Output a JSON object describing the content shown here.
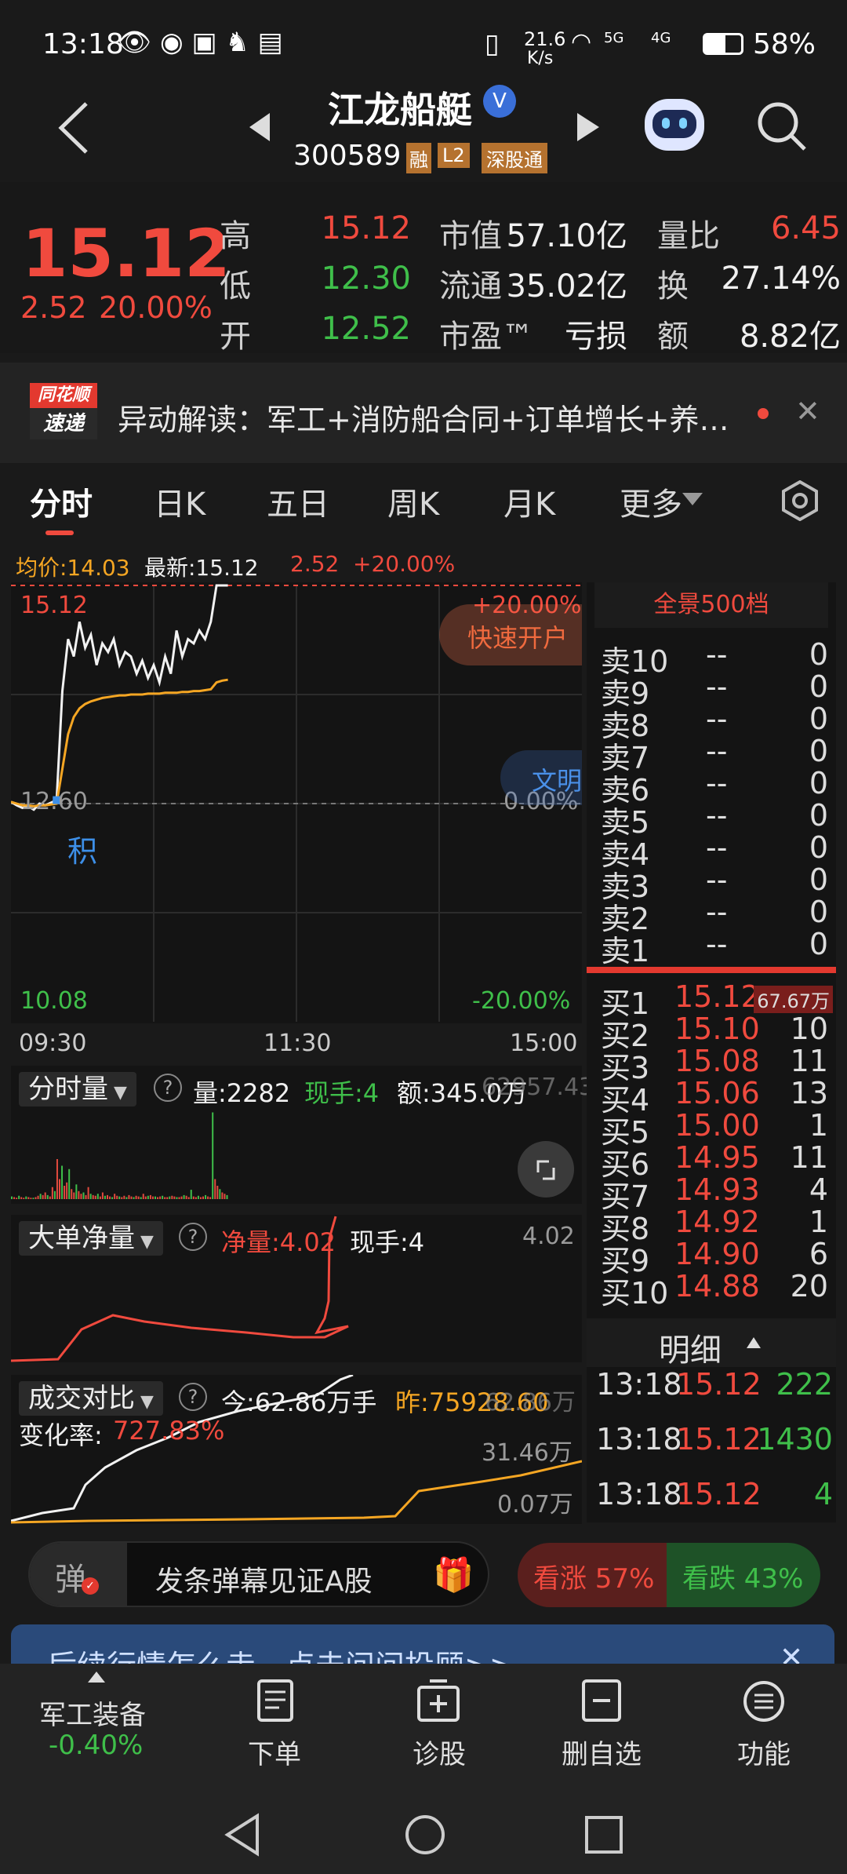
{
  "status": {
    "time": "13:18",
    "net_speed_top": "21.6",
    "net_speed_bottom": "K/s",
    "signal1": "5G",
    "signal2": "4G",
    "battery": "58%"
  },
  "header": {
    "title": "江龙船艇",
    "badge": "V",
    "code": "300589",
    "tags": [
      "融",
      "L2",
      "深股通"
    ]
  },
  "quote": {
    "price": "15.12",
    "change": "2.52",
    "change_pct": "20.00%",
    "rows": [
      [
        {
          "l": "高",
          "v": "15.12",
          "c": "red"
        },
        {
          "l": "市值",
          "v": "57.10亿"
        },
        {
          "l": "量比",
          "v": "6.45",
          "c": "red"
        }
      ],
      [
        {
          "l": "低",
          "v": "12.30",
          "c": "green"
        },
        {
          "l": "流通",
          "v": "35.02亿"
        },
        {
          "l": "换",
          "v": "27.14%"
        }
      ],
      [
        {
          "l": "开",
          "v": "12.52",
          "c": "green"
        },
        {
          "l": "市盈™",
          "v": "亏损"
        },
        {
          "l": "额",
          "v": "8.82亿"
        }
      ]
    ]
  },
  "news": {
    "logo_top": "同花顺",
    "logo_bottom": "速递",
    "text": "异动解读：军工+消防船合同+订单增长+养…"
  },
  "tabs": [
    "分时",
    "日K",
    "五日",
    "周K",
    "月K",
    "更多"
  ],
  "info_line": {
    "avg": "均价:14.03",
    "latest": "最新:15.12",
    "chg": "2.52",
    "pct": "+20.00%"
  },
  "chart_data": {
    "type": "line",
    "title": "",
    "x": [
      "09:30",
      "11:30",
      "15:00"
    ],
    "ylim": [
      10.08,
      15.12
    ],
    "y_labels": {
      "top": "15.12",
      "mid": "12.60",
      "bottom": "10.08",
      "top_pct": "+20.00%",
      "mid_pct": "0.00%",
      "bottom_pct": "-20.00%"
    },
    "series": [
      {
        "name": "",
        "values": [
          12.62,
          12.58,
          12.55,
          12.57,
          12.53,
          12.6,
          12.58,
          12.61,
          12.64,
          13.9,
          14.5,
          14.3,
          14.7,
          14.4,
          14.55,
          14.2,
          14.45,
          14.35,
          14.5,
          14.2,
          14.35,
          14.3,
          14.1,
          14.25,
          14.05,
          14.2,
          14.0,
          14.3,
          14.1,
          14.6,
          14.3,
          14.5,
          14.45,
          14.6,
          14.5,
          14.7,
          15.12,
          15.12,
          15.12
        ]
      },
      {
        "name": "",
        "values": [
          12.62,
          12.6,
          12.58,
          12.58,
          12.57,
          12.58,
          12.58,
          12.59,
          12.6,
          13.0,
          13.4,
          13.6,
          13.7,
          13.75,
          13.78,
          13.8,
          13.82,
          13.83,
          13.84,
          13.85,
          13.85,
          13.86,
          13.86,
          13.86,
          13.87,
          13.87,
          13.87,
          13.88,
          13.88,
          13.88,
          13.89,
          13.89,
          13.9,
          13.9,
          13.91,
          13.92,
          14.0,
          14.02,
          14.03
        ]
      }
    ],
    "annotation": "积"
  },
  "side_badges": {
    "kaihu": "快速开户",
    "wenming": "文明"
  },
  "volume_panel": {
    "label": "分时量",
    "vol": "量:2282",
    "xianshou": "现手:4",
    "amount": "额:345.0万",
    "right": "62957.43"
  },
  "bigorder_panel": {
    "label": "大单净量",
    "net": "净量:4.02",
    "xianshou": "现手:4",
    "right": "4.02"
  },
  "compare_panel": {
    "label": "成交对比",
    "today": "今:62.86万手",
    "yesterday": "昨:75928.60",
    "rate_label": "变化率:",
    "rate": "727.83%",
    "right_top": "62.86万",
    "right_mid": "31.46万",
    "right_bot": "0.07万"
  },
  "orderbook": {
    "title": "全景500档",
    "sells": [
      [
        "卖10",
        "--",
        "0"
      ],
      [
        "卖9",
        "--",
        "0"
      ],
      [
        "卖8",
        "--",
        "0"
      ],
      [
        "卖7",
        "--",
        "0"
      ],
      [
        "卖6",
        "--",
        "0"
      ],
      [
        "卖5",
        "--",
        "0"
      ],
      [
        "卖4",
        "--",
        "0"
      ],
      [
        "卖3",
        "--",
        "0"
      ],
      [
        "卖2",
        "--",
        "0"
      ],
      [
        "卖1",
        "--",
        "0"
      ]
    ],
    "buys": [
      [
        "买1",
        "15.12",
        "67.67万"
      ],
      [
        "买2",
        "15.10",
        "10"
      ],
      [
        "买3",
        "15.08",
        "11"
      ],
      [
        "买4",
        "15.06",
        "13"
      ],
      [
        "买5",
        "15.00",
        "1"
      ],
      [
        "买6",
        "14.95",
        "11"
      ],
      [
        "买7",
        "14.93",
        "4"
      ],
      [
        "买8",
        "14.92",
        "1"
      ],
      [
        "买9",
        "14.90",
        "6"
      ],
      [
        "买10",
        "14.88",
        "20"
      ]
    ],
    "detail_title": "明细",
    "details": [
      [
        "13:18",
        "15.12",
        "222"
      ],
      [
        "13:18",
        "15.12",
        "1430"
      ],
      [
        "13:18",
        "15.12",
        "4"
      ]
    ]
  },
  "danmu": {
    "icon": "弹",
    "placeholder": "发条弹幕见证A股",
    "up": "看涨 57%",
    "down": "看跌 43%"
  },
  "banner": {
    "text": "后续行情怎么走，点击问问投顾>>"
  },
  "bottom_nav": {
    "sector": "军工装备",
    "sector_chg": "-0.40%",
    "items": [
      "下单",
      "诊股",
      "删自选",
      "功能"
    ]
  }
}
